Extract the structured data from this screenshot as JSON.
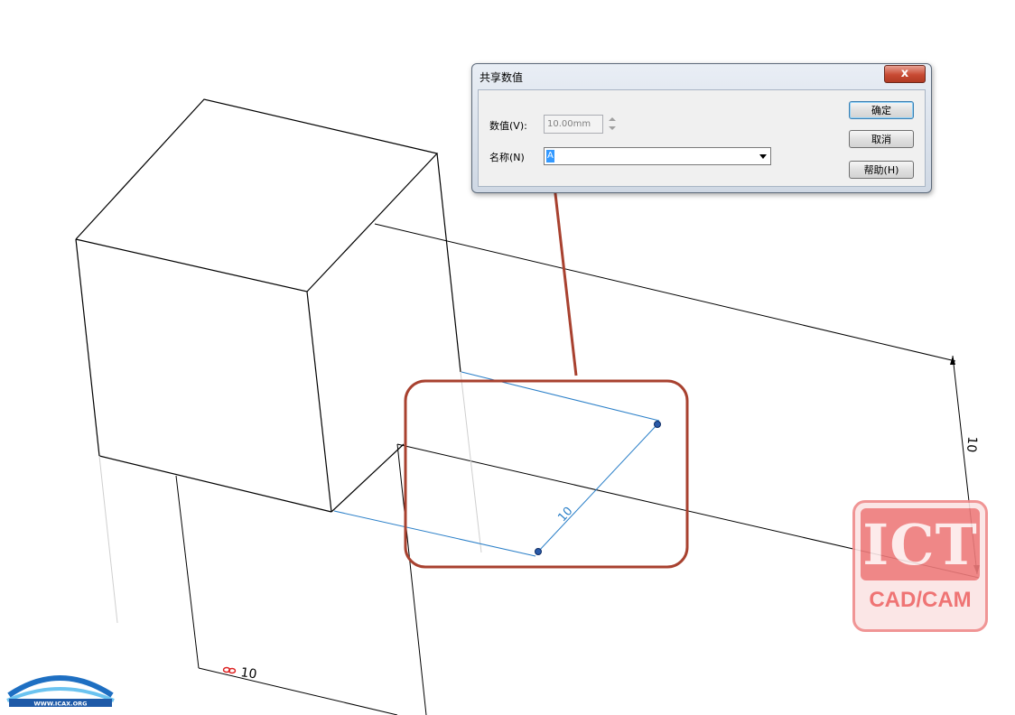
{
  "dialog": {
    "title": "共享数值",
    "close_label": "x",
    "value_label": "数值(V):",
    "value_field": "10.00mm",
    "name_label": "名称(N)",
    "name_field": "A",
    "ok_label": "确定",
    "cancel_label": "取消",
    "help_label": "帮助(H)"
  },
  "drawing": {
    "dimension_right": "10",
    "dimension_sketch": "10",
    "dimension_bottom": "10",
    "dimension_bottom_icon": "link-icon"
  },
  "watermark": {
    "ict_text": "ICT",
    "ict_subtext": "CAD/CAM",
    "icax_text": "ICAX",
    "icax_url": "WWW.ICAX.ORG"
  },
  "colors": {
    "highlight": "#a8412f",
    "sketch": "#2a7fc8",
    "dialog_select": "#3399ff"
  }
}
